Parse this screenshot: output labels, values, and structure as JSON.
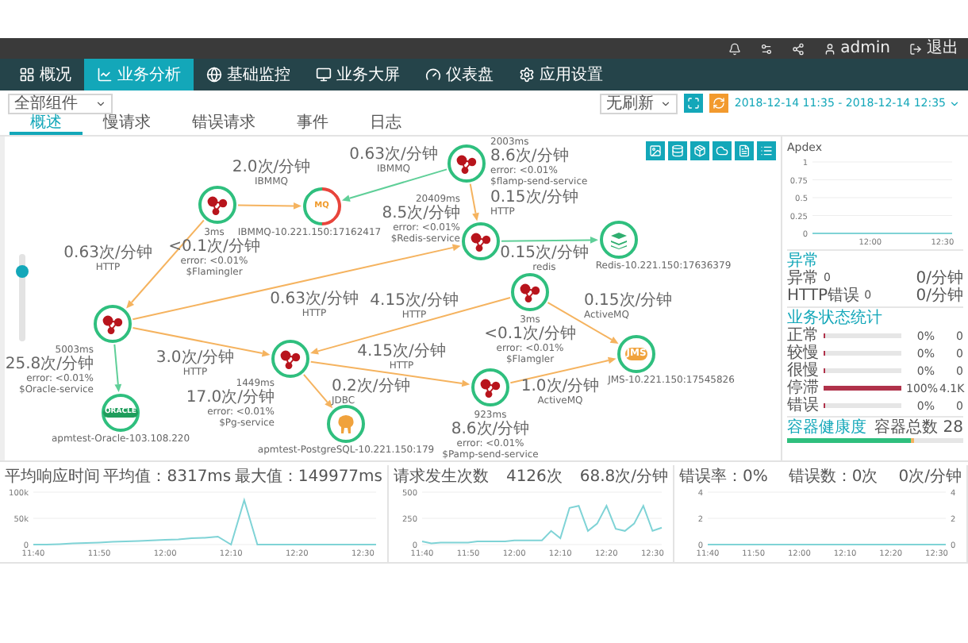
{
  "top_bar": {
    "user": "admin",
    "logout": "退出"
  },
  "nav": [
    {
      "label": "概况",
      "selected": false
    },
    {
      "label": "业务分析",
      "selected": true
    },
    {
      "label": "基础监控",
      "selected": false
    },
    {
      "label": "业务大屏",
      "selected": false
    },
    {
      "label": "仪表盘",
      "selected": false
    },
    {
      "label": "应用设置",
      "selected": false
    }
  ],
  "filter": {
    "component_select": "全部组件",
    "refresh_select": "无刷新",
    "time_range": "2018-12-14 11:35 - 2018-12-14 12:35"
  },
  "tabs": [
    {
      "label": "概述",
      "selected": true
    },
    {
      "label": "慢请求",
      "selected": false
    },
    {
      "label": "错误请求",
      "selected": false
    },
    {
      "label": "事件",
      "selected": false
    },
    {
      "label": "日志",
      "selected": false
    }
  ],
  "topology": {
    "zoom": {
      "level": 0.8
    },
    "nodes": [
      {
        "kind": "service",
        "alert": false,
        "metrics": [
          "2003ms",
          "8.6次/分钟",
          "error: <0.01%",
          "$flamp-send-service"
        ]
      },
      {
        "kind": "service",
        "alert": false,
        "metrics": [
          "3ms",
          "<0.1次/分钟",
          "error: <0.01%",
          "$Flamingler"
        ]
      },
      {
        "kind": "mq",
        "alert": true,
        "badge": "MQ",
        "label": "IBMMQ-10.221.150:17162417"
      },
      {
        "kind": "service",
        "alert": false,
        "metrics": [
          "20409ms",
          "8.5次/分钟",
          "error: <0.01%",
          "$Redis-service"
        ]
      },
      {
        "kind": "cache",
        "alert": false,
        "label": "Redis-10.221.150:17636379"
      },
      {
        "kind": "service",
        "alert": false,
        "metrics": [
          "3ms",
          "<0.1次/分钟",
          "error: <0.01%",
          "$Flamgler"
        ]
      },
      {
        "kind": "service",
        "alert": false,
        "metrics": [
          "5003ms",
          "25.8次/分钟",
          "error: <0.01%",
          "$Oracle-service"
        ]
      },
      {
        "kind": "service",
        "alert": false,
        "metrics": [
          "1449ms",
          "17.0次/分钟",
          "error: <0.01%",
          "$Pg-service"
        ]
      },
      {
        "kind": "jms",
        "alert": false,
        "badge": "JMS",
        "label": "JMS-10.221.150:17545826"
      },
      {
        "kind": "oracle",
        "alert": false,
        "badge": "ORACLE",
        "label": "apmtest-Oracle-103.108.220"
      },
      {
        "kind": "postgres",
        "alert": false,
        "label": "apmtest-PostgreSQL-10.221.150:179"
      },
      {
        "kind": "service",
        "alert": false,
        "metrics": [
          "923ms",
          "8.6次/分钟",
          "error: <0.01%",
          "$Pamp-send-service"
        ]
      }
    ],
    "edges": [
      {
        "slow": true,
        "rate": "2.0次/分钟",
        "protocol": "IBMMQ"
      },
      {
        "slow": false,
        "rate": "0.63次/分钟",
        "protocol": "IBMMQ"
      },
      {
        "slow": true,
        "rate": "0.15次/分钟",
        "protocol": "HTTP"
      },
      {
        "slow": true,
        "rate": "0.63次/分钟",
        "protocol": "HTTP"
      },
      {
        "slow": false,
        "rate": "0.15次/分钟",
        "protocol": "redis"
      },
      {
        "slow": true,
        "rate": "0.63次/分钟",
        "protocol": "HTTP"
      },
      {
        "slow": true,
        "rate": "4.15次/分钟",
        "protocol": "HTTP"
      },
      {
        "slow": true,
        "rate": "0.15次/分钟",
        "protocol": "ActiveMQ"
      },
      {
        "slow": true,
        "rate": "3.0次/分钟",
        "protocol": "HTTP"
      },
      {
        "slow": true,
        "rate": "4.15次/分钟",
        "protocol": "HTTP"
      },
      {
        "slow": true,
        "rate": "0.2次/分钟",
        "protocol": "JDBC"
      },
      {
        "slow": true,
        "rate": "1.0次/分钟",
        "protocol": "ActiveMQ"
      },
      {
        "slow": false
      }
    ]
  },
  "apdex": {
    "title": "Apdex",
    "chart_data": {
      "type": "line",
      "categories": [
        null,
        null,
        null,
        null,
        null,
        null,
        null,
        null,
        null,
        null,
        null,
        null,
        "12:00",
        null,
        null,
        null,
        null,
        null,
        null,
        null,
        null,
        null,
        null,
        null,
        null,
        null,
        null,
        "12:30",
        null,
        null
      ],
      "series": [
        {
          "color": "#7fd3d6",
          "values": [
            0,
            0,
            0,
            0,
            0,
            0,
            0,
            0,
            0,
            0,
            0,
            0,
            0,
            0,
            0,
            0,
            0,
            0,
            0,
            0,
            0,
            0,
            0,
            0,
            0,
            0,
            0,
            0,
            0,
            0
          ]
        }
      ],
      "ylim": [
        0,
        1
      ],
      "yticks": [
        0,
        0.25,
        0.5,
        0.75,
        1
      ],
      "grid": true
    }
  },
  "anomalies": {
    "title": "异常",
    "rows": [
      {
        "label": "异常",
        "count": "0",
        "rate": "0/分钟"
      },
      {
        "label": "HTTP错误",
        "count": "0",
        "rate": "0/分钟"
      }
    ]
  },
  "status_stats": {
    "title": "业务状态统计",
    "rows": [
      {
        "label": "正常",
        "level": 0,
        "percent": "0%",
        "count": "0"
      },
      {
        "label": "较慢",
        "level": 0,
        "percent": "0%",
        "count": "0"
      },
      {
        "label": "很慢",
        "level": 0,
        "percent": "0%",
        "count": "0"
      },
      {
        "label": "停滞",
        "level": 1,
        "percent": "100%",
        "count": "4.1K"
      },
      {
        "label": "错误",
        "level": 0,
        "percent": "0%",
        "count": "0"
      }
    ]
  },
  "container_health": {
    "title": "容器健康度",
    "total": "容器总数 28",
    "level": 0.72
  },
  "charts": [
    {
      "title": "平均响应时间",
      "stat_1": "平均值：8317ms",
      "stat_2": "最大值：149977ms",
      "chart_data": {
        "type": "line",
        "categories": [
          "11:40",
          null,
          null,
          null,
          null,
          "11:50",
          null,
          null,
          null,
          null,
          "12:00",
          null,
          null,
          null,
          null,
          "12:10",
          null,
          null,
          null,
          null,
          "12:20",
          null,
          null,
          null,
          null,
          "12:30",
          null
        ],
        "series": [
          {
            "color": "#7fd3d6",
            "values": [
              0,
              0,
              1000,
              2000,
              3000,
              4000,
              5000,
              6000,
              7000,
              8000,
              9000,
              10000,
              12000,
              13000,
              15000,
              0,
              85000,
              0,
              0,
              0,
              0,
              0,
              0,
              0,
              0,
              0,
              0
            ]
          }
        ],
        "ylim": [
          0,
          100000
        ],
        "yticks": [
          0,
          {
            "value": 50000,
            "label": "50k"
          },
          {
            "value": 100000,
            "label": "100k"
          }
        ],
        "grid": true
      }
    },
    {
      "title": "请求发生次数",
      "stat_1": "4126次",
      "stat_2": "68.8次/分钟",
      "chart_data": {
        "type": "line",
        "categories": [
          "11:40",
          null,
          null,
          null,
          null,
          "11:50",
          null,
          null,
          null,
          null,
          "12:00",
          null,
          null,
          null,
          null,
          "12:10",
          null,
          null,
          null,
          null,
          "12:20",
          null,
          null,
          null,
          null,
          "12:30",
          null
        ],
        "series": [
          {
            "color": "#7fd3d6",
            "values": [
              30,
              10,
              20,
              20,
              20,
              20,
              30,
              30,
              30,
              30,
              40,
              40,
              40,
              40,
              130,
              60,
              350,
              370,
              130,
              200,
              370,
              150,
              130,
              200,
              370,
              130,
              160
            ]
          }
        ],
        "ylim": [
          0,
          500
        ],
        "yticks": [
          0,
          250,
          500
        ],
        "grid": true
      }
    },
    {
      "title": "错误率：0%",
      "stat_1": "错误数：0次",
      "stat_2": "0次/分钟",
      "right_axis_ticks": [
        "4",
        "2",
        "0"
      ],
      "chart_data": {
        "type": "line",
        "categories": [
          "11:40",
          null,
          null,
          null,
          null,
          "11:50",
          null,
          null,
          null,
          null,
          "12:00",
          null,
          null,
          null,
          null,
          "12:10",
          null,
          null,
          null,
          null,
          "12:20",
          null,
          null,
          null,
          null,
          "12:30",
          null
        ],
        "series": [
          {
            "color": "#7fd3d6",
            "values": [
              0,
              0,
              0,
              0,
              0,
              0,
              0,
              0,
              0,
              0,
              0,
              0,
              0,
              0,
              0,
              0,
              0,
              0,
              0,
              0,
              0,
              0,
              0,
              0,
              0,
              0,
              0
            ]
          }
        ],
        "ylim": [
          0,
          4
        ],
        "yticks": [
          {
            "value": 0,
            "label": "0"
          },
          {
            "value": 2,
            "label": "2"
          },
          {
            "value": 4,
            "label": "4"
          }
        ],
        "grid": true
      }
    }
  ]
}
